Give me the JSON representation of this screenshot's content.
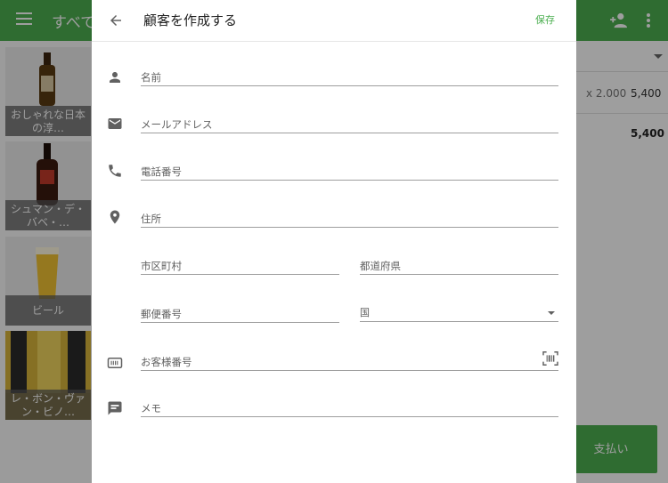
{
  "app": {
    "category_title": "すべて",
    "order": {
      "quantity": "x 2.000",
      "line_price": "5,400",
      "total": "5,400"
    },
    "pay_button": "支払い",
    "products": [
      {
        "label": "おしゃれな日本の淳…",
        "bottle_color": "#5a3a12"
      },
      {
        "label": "シュマン・デ・バベ・…",
        "bottle_color": "#3a1a10"
      },
      {
        "label": "ビール",
        "bottle_color": "#f1c232"
      },
      {
        "label": "レ・ボン・ヴァン・ビノ…",
        "bottle_color": "#2a2a2a"
      }
    ]
  },
  "dialog": {
    "title": "顧客を作成する",
    "save_label": "保存",
    "fields": {
      "name": {
        "placeholder": "名前",
        "icon": "person-icon"
      },
      "email": {
        "placeholder": "メールアドレス",
        "icon": "email-icon"
      },
      "phone": {
        "placeholder": "電話番号",
        "icon": "phone-icon"
      },
      "address": {
        "placeholder": "住所",
        "icon": "location-pin-icon"
      },
      "city": {
        "placeholder": "市区町村"
      },
      "prefecture": {
        "placeholder": "都道府県"
      },
      "postal_code": {
        "placeholder": "郵便番号"
      },
      "country": {
        "label": "国"
      },
      "customer_number": {
        "placeholder": "お客様番号",
        "icon": "card-icon"
      },
      "memo": {
        "placeholder": "メモ",
        "icon": "comment-icon"
      }
    }
  },
  "colors": {
    "brand_green": "#4caf50",
    "icon_gray": "#616161"
  }
}
